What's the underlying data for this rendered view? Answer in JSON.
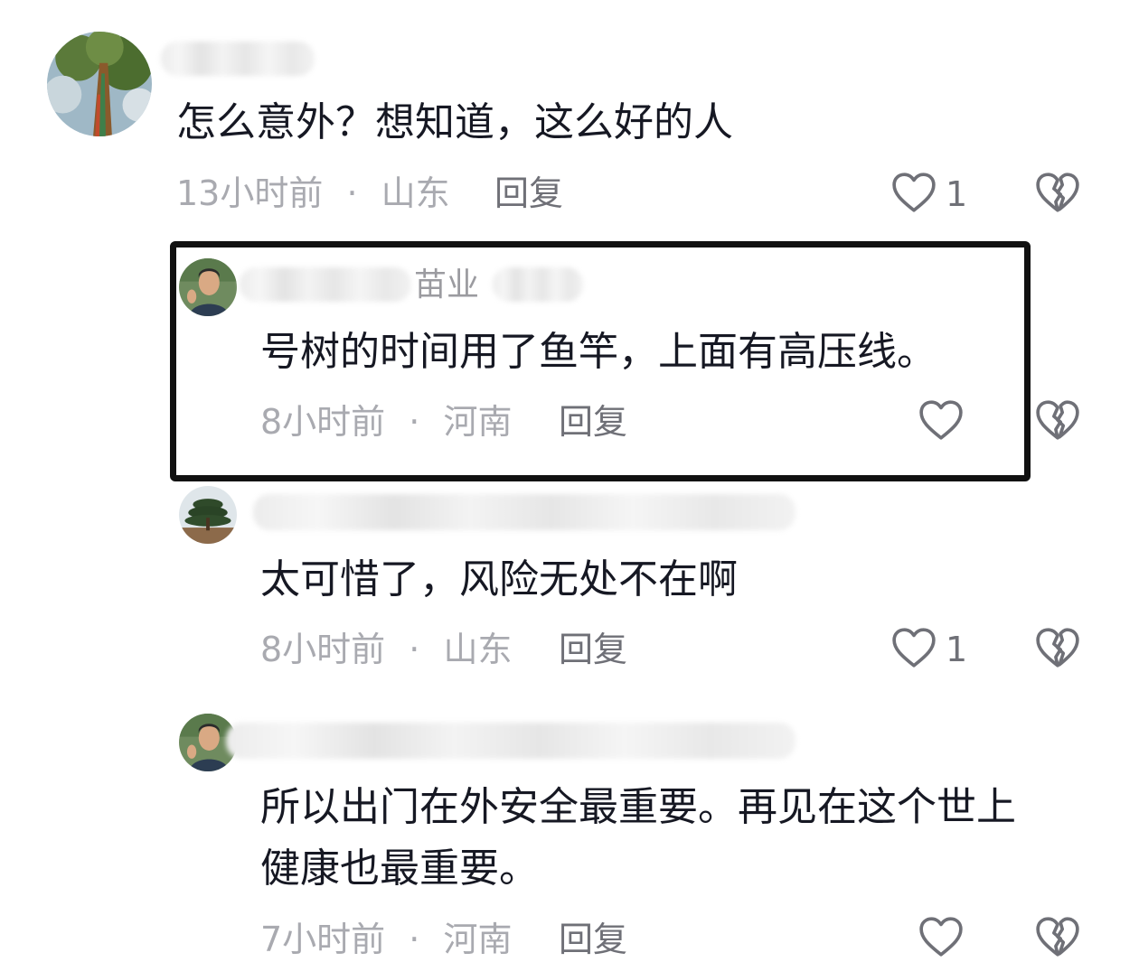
{
  "comments": [
    {
      "avatar": "tree-avatar",
      "content": "怎么意外？想知道，这么好的人",
      "time": "13小时前",
      "location": "山东",
      "reply_label": "回复",
      "like_count": "1"
    },
    {
      "avatar": "man-avatar",
      "name_visible": "苗业",
      "content": "号树的时间用了鱼竿，上面有高压线。",
      "time": "8小时前",
      "location": "河南",
      "reply_label": "回复",
      "like_count": ""
    },
    {
      "avatar": "pine-avatar",
      "content": "太可惜了，风险无处不在啊",
      "time": "8小时前",
      "location": "山东",
      "reply_label": "回复",
      "like_count": "1"
    },
    {
      "avatar": "man-avatar",
      "content_line1": "所以出门在外安全最重要。再见在这个世上",
      "content_line2": "健康也最重要。",
      "time": "7小时前",
      "location": "河南",
      "reply_label": "回复",
      "like_count": ""
    }
  ],
  "separator": "·",
  "icons": {
    "like": "heart-outline-icon",
    "dislike": "broken-heart-icon"
  }
}
